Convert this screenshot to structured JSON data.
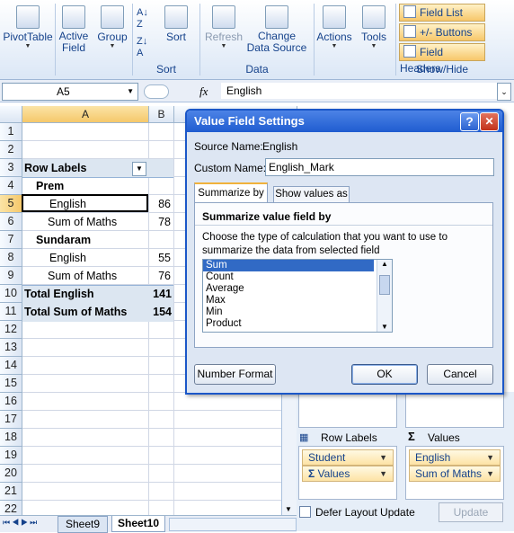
{
  "ribbon": {
    "pivottable": "PivotTable",
    "active_field": "Active Field",
    "group": "Group",
    "sort": "Sort",
    "sort_group_label": "Sort",
    "refresh": "Refresh",
    "change_data_source": "Change Data Source",
    "data_group_label": "Data",
    "actions": "Actions",
    "tools": "Tools",
    "field_list": "Field List",
    "plus_minus_buttons": "+/- Buttons",
    "field_headers": "Field Headers",
    "showhide_label": "Show/Hide"
  },
  "formula_bar": {
    "name_box": "A5",
    "fx": "fx",
    "content": "English"
  },
  "grid": {
    "columns": [
      "A",
      "B"
    ],
    "rows": [
      "1",
      "2",
      "3",
      "4",
      "5",
      "6",
      "7",
      "8",
      "9",
      "10",
      "11",
      "12",
      "13",
      "14",
      "15",
      "16",
      "17",
      "18",
      "19",
      "20",
      "21",
      "22"
    ],
    "cells": {
      "r3": "Row Labels",
      "r4": "Prem",
      "r5a": "English",
      "r5b": "86",
      "r6a": "Sum of Maths",
      "r6b": "78",
      "r7": "Sundaram",
      "r8a": "English",
      "r8b": "55",
      "r9a": "Sum of Maths",
      "r9b": "76",
      "r10a": "Total  English",
      "r10b": "141",
      "r11a": "Total Sum of Maths",
      "r11b": "154"
    }
  },
  "sheet_tabs": [
    "Sheet9",
    "Sheet10"
  ],
  "dialog": {
    "title": "Value Field Settings",
    "help": "?",
    "close": "✕",
    "source_name_label": "Source Name:",
    "source_name_value": "English",
    "custom_name_label": "Custom Name:",
    "custom_name_value": "English_Mark",
    "tab_summarize": "Summarize by",
    "tab_show_values": "Show values as",
    "section_heading": "Summarize value field by",
    "description": "Choose the type of calculation that you want to use to summarize the data from selected field",
    "options": [
      "Sum",
      "Count",
      "Average",
      "Max",
      "Min",
      "Product"
    ],
    "selected_option": "Sum",
    "number_format": "Number Format",
    "ok": "OK",
    "cancel": "Cancel"
  },
  "field_list": {
    "row_labels_header": "Row Labels",
    "values_header": "Values",
    "row_items": [
      "Student",
      "Values"
    ],
    "value_items": [
      "English",
      "Sum of Maths"
    ],
    "defer_label": "Defer Layout Update",
    "update": "Update"
  }
}
